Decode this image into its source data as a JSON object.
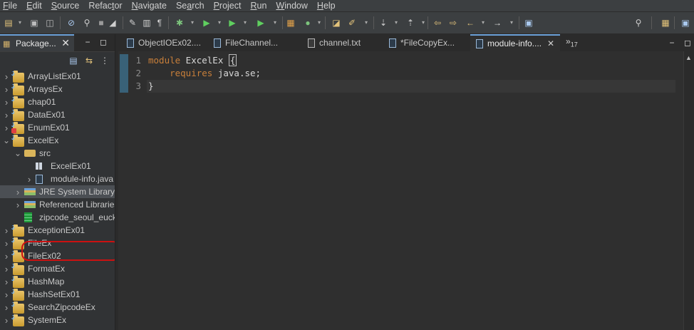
{
  "menubar": {
    "items": [
      {
        "mn": "F",
        "rest": "ile"
      },
      {
        "mn": "E",
        "rest": "dit"
      },
      {
        "mn": "S",
        "rest": "ource"
      },
      {
        "pre": "Refac",
        "mn": "t",
        "rest": "or"
      },
      {
        "mn": "N",
        "rest": "avigate"
      },
      {
        "pre": "Se",
        "mn": "a",
        "rest": "rch"
      },
      {
        "mn": "P",
        "rest": "roject"
      },
      {
        "mn": "R",
        "rest": "un"
      },
      {
        "mn": "W",
        "rest": "indow"
      },
      {
        "mn": "H",
        "rest": "elp"
      }
    ]
  },
  "left_panel": {
    "tab_label": "Package...",
    "tab_close": "✕"
  },
  "tree": [
    {
      "label": "ArrayListEx01",
      "kind": "project",
      "expanded": false
    },
    {
      "label": "ArraysEx",
      "kind": "project",
      "expanded": false
    },
    {
      "label": "chap01",
      "kind": "project",
      "expanded": false
    },
    {
      "label": "DataEx01",
      "kind": "project",
      "expanded": false
    },
    {
      "label": "EnumEx01",
      "kind": "project-error",
      "expanded": false
    },
    {
      "label": "ExcelEx",
      "kind": "project",
      "expanded": true
    },
    {
      "label": "src",
      "kind": "source-folder",
      "expanded": true
    },
    {
      "label": "ExcelEx01",
      "kind": "package"
    },
    {
      "label": "module-info.java",
      "kind": "java-file"
    },
    {
      "label": "JRE System Library",
      "kind": "library",
      "selected": true
    },
    {
      "label": "Referenced Libraries",
      "kind": "library"
    },
    {
      "label": "zipcode_seoul_euckr",
      "kind": "excel-file"
    },
    {
      "label": "ExceptionEx01",
      "kind": "project",
      "expanded": false
    },
    {
      "label": "FileEx",
      "kind": "project",
      "expanded": false
    },
    {
      "label": "FileEx02",
      "kind": "project",
      "expanded": false
    },
    {
      "label": "FormatEx",
      "kind": "project",
      "expanded": false
    },
    {
      "label": "HashMap",
      "kind": "project",
      "expanded": false
    },
    {
      "label": "HashSetEx01",
      "kind": "project",
      "expanded": false
    },
    {
      "label": "SearchZipcodeEx",
      "kind": "project",
      "expanded": false
    },
    {
      "label": "SystemEx",
      "kind": "project",
      "expanded": false
    }
  ],
  "editor": {
    "tabs": [
      {
        "label": "ObjectIOEx02....",
        "type": "java"
      },
      {
        "label": "FileChannel...",
        "type": "java"
      },
      {
        "label": "channel.txt",
        "type": "txt"
      },
      {
        "label": "*FileCopyEx...",
        "type": "java"
      },
      {
        "label": "module-info....",
        "type": "java",
        "active": true
      }
    ],
    "active_tab_close": "✕",
    "overflow_label": "»",
    "overflow_count": "17",
    "lines": [
      {
        "num": "1",
        "kw": "module",
        "rest": " ExcelEx ",
        "brace": "{"
      },
      {
        "num": "2",
        "indent": "    ",
        "kw": "requires",
        "rest": " java.se;"
      },
      {
        "num": "3",
        "rest": "}"
      }
    ]
  },
  "colors": {
    "keyword": "#c87f3a",
    "background": "#2b2b2b",
    "annotation_circle": "#cc1111"
  }
}
